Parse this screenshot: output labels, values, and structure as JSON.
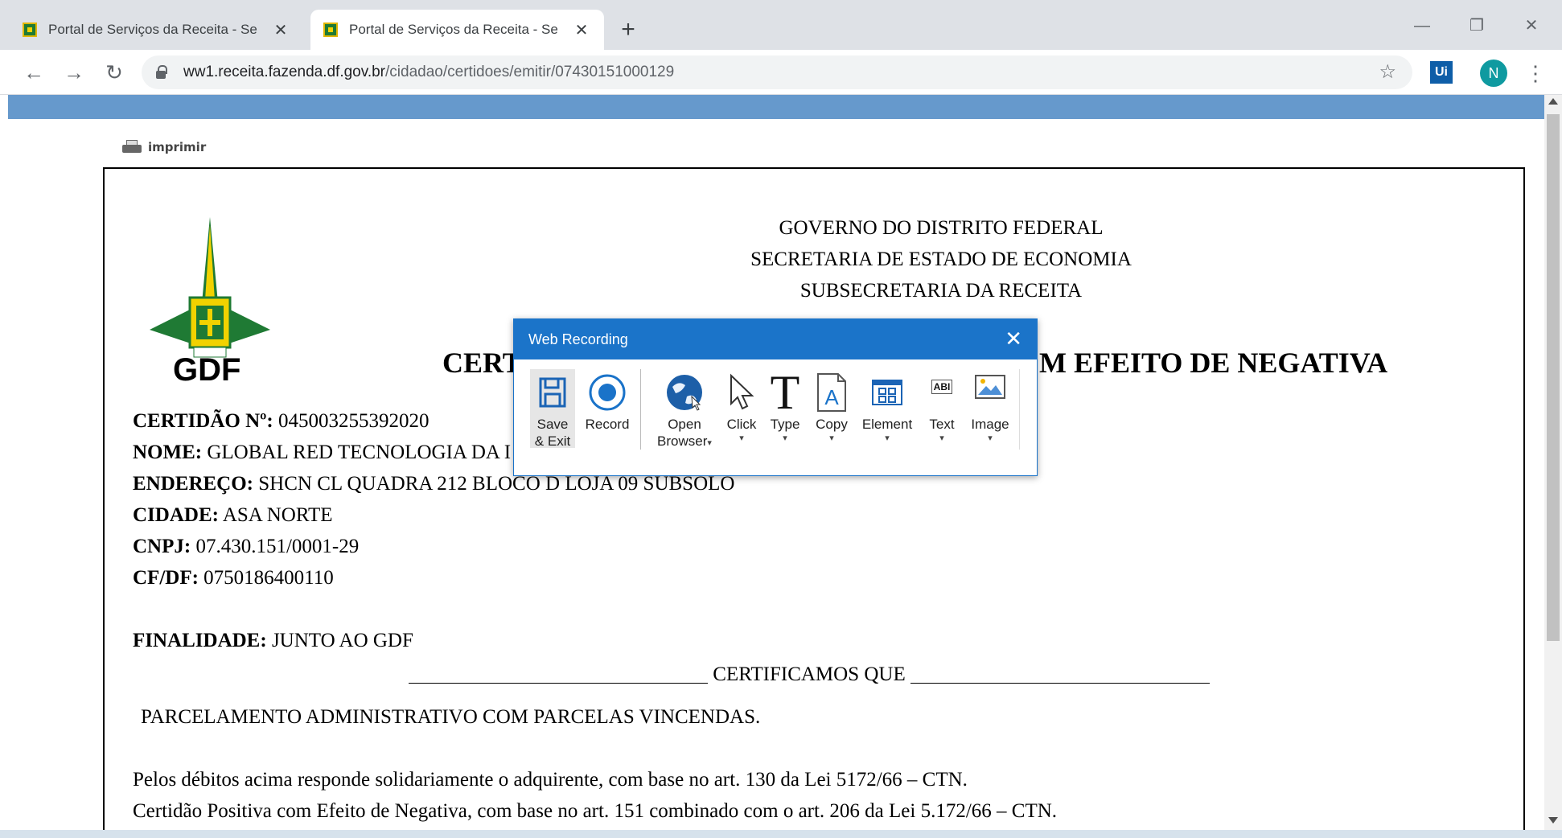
{
  "browser": {
    "tabs": [
      {
        "title": "Portal de Serviços da Receita - Se",
        "active": false
      },
      {
        "title": "Portal de Serviços da Receita - Se",
        "active": true
      }
    ],
    "close_glyph": "✕",
    "new_tab_glyph": "+",
    "window_controls": {
      "minimize": "—",
      "restore": "❐",
      "close": "✕"
    },
    "nav": {
      "back": "←",
      "forward": "→",
      "reload": "↻"
    },
    "url_host": "ww1.receita.fazenda.df.gov.br",
    "url_path": "/cidadao/certidoes/emitir/07430151000129",
    "bookmark_glyph": "☆",
    "extension_label": "Ui",
    "profile_initial": "N",
    "menu_glyph": "⋮"
  },
  "page": {
    "print_label": "imprimir",
    "logo_text": "GDF",
    "header_lines": [
      "GOVERNO DO DISTRITO FEDERAL",
      "SECRETARIA DE ESTADO DE ECONOMIA",
      "SUBSECRETARIA DA RECEITA"
    ],
    "title_left": "CERT",
    "title_right": "M EFEITO DE NEGATIVA",
    "fields": [
      {
        "label": "CERTIDÃO Nº:",
        "value": "045003255392020"
      },
      {
        "label": "NOME:",
        "value": "GLOBAL RED TECNOLOGIA DA I"
      },
      {
        "label": "ENDEREÇO:",
        "value": "SHCN CL QUADRA 212 BLOCO D LOJA 09 SUBSOLO"
      },
      {
        "label": "CIDADE:",
        "value": "ASA NORTE"
      },
      {
        "label": "CNPJ:",
        "value": "07.430.151/0001-29"
      },
      {
        "label": "CF/DF:",
        "value": "0750186400110"
      }
    ],
    "finalidade": {
      "label": "FINALIDADE:",
      "value": "JUNTO AO GDF"
    },
    "certificamos": "CERTIFICAMOS QUE",
    "line1": "PARCELAMENTO ADMINISTRATIVO COM PARCELAS VINCENDAS.",
    "line2": "Pelos débitos acima responde solidariamente o adquirente, com base no art. 130 da Lei 5172/66 – CTN.",
    "line3": "Certidão Positiva com Efeito de Negativa, com base no art. 151 combinado com o art. 206 da Lei 5.172/66 – CTN."
  },
  "recorder": {
    "title": "Web Recording",
    "close_glyph": "✕",
    "tools": [
      {
        "label1": "Save",
        "label2": "& Exit"
      },
      {
        "label1": "Record"
      },
      {
        "label1": "Open",
        "label2": "Browser",
        "caret": true
      },
      {
        "label1": "Click",
        "caret": true
      },
      {
        "label1": "Type",
        "caret": true
      },
      {
        "label1": "Copy",
        "caret": true
      },
      {
        "label1": "Element",
        "caret": true
      },
      {
        "label1": "Text",
        "caret": true
      },
      {
        "label1": "Image",
        "caret": true
      }
    ],
    "caret_glyph": "▾",
    "type_glyph": "T",
    "text_glyph": "ABI",
    "copy_glyph": "A"
  },
  "colors": {
    "blue_bar": "#6699cc",
    "recorder_title": "#1b74c9",
    "record_dot": "#1a73c9",
    "emblem_green": "#1f7a34",
    "emblem_yellow": "#f2d200"
  }
}
